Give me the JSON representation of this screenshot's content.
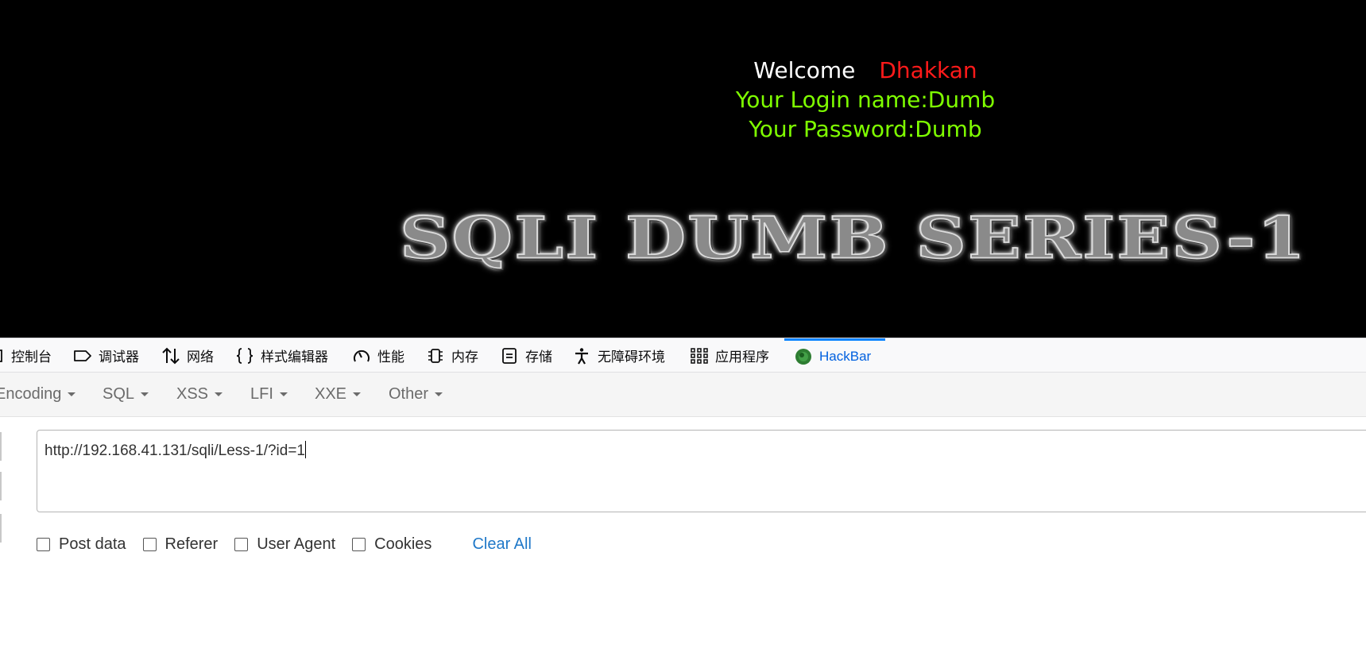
{
  "page": {
    "welcome_label": "Welcome",
    "user_name": "Dhakkan",
    "login_line": "Your Login name:Dumb",
    "password_line": "Your Password:Dumb",
    "banner_text": "SQLI DUMB SERIES-1",
    "colors": {
      "background": "#000000",
      "welcome": "#ffffff",
      "name": "#ff1a1a",
      "info": "#7fff00"
    }
  },
  "devtools": {
    "tabs": [
      {
        "label": "控制台",
        "icon": "console-icon"
      },
      {
        "label": "调试器",
        "icon": "debugger-icon"
      },
      {
        "label": "网络",
        "icon": "network-arrows-icon"
      },
      {
        "label": "样式编辑器",
        "icon": "braces-icon"
      },
      {
        "label": "性能",
        "icon": "gauge-icon"
      },
      {
        "label": "内存",
        "icon": "memory-chip-icon"
      },
      {
        "label": "存储",
        "icon": "storage-icon"
      },
      {
        "label": "无障碍环境",
        "icon": "accessibility-icon"
      },
      {
        "label": "应用程序",
        "icon": "app-grid-icon"
      },
      {
        "label": "HackBar",
        "icon": "hackbar-icon",
        "active": true
      }
    ],
    "accent": "#0a84ff"
  },
  "hackbar": {
    "menus": [
      "Encoding",
      "SQL",
      "XSS",
      "LFI",
      "XXE",
      "Other"
    ],
    "url_value": "http://192.168.41.131/sqli/Less-1/?id=1",
    "options": [
      "Post data",
      "Referer",
      "User Agent",
      "Cookies"
    ],
    "clear_all": "Clear All"
  }
}
